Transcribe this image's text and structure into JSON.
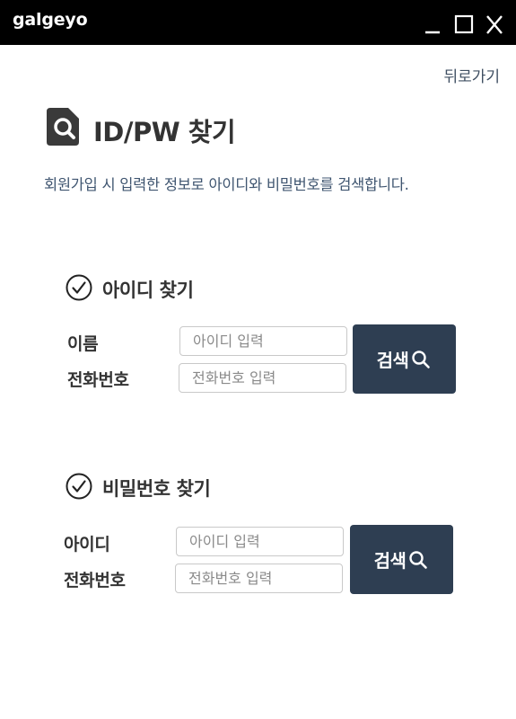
{
  "window": {
    "title": "galgeyo",
    "controls": [
      "minimize-icon",
      "maximize-icon",
      "close-icon"
    ]
  },
  "header": {
    "back_label": "뒤로가기",
    "title": "ID/PW 찾기",
    "description": "회원가입 시 입력한 정보로 아이디와 비밀번호를 검색합니다."
  },
  "find_id": {
    "title": "아이디 찾기",
    "name_label": "이름",
    "name_placeholder": "아이디 입력",
    "phone_label": "전화번호",
    "phone_placeholder": "전화번호 입력",
    "search_label": "검색"
  },
  "find_pw": {
    "title": "비밀번호 찾기",
    "id_label": "아이디",
    "id_placeholder": "아이디 입력",
    "phone_label": "전화번호",
    "phone_placeholder": "전화번호 입력",
    "search_label": "검색"
  },
  "colors": {
    "titlebar": "#000000",
    "button": "#2e3e52",
    "description_text": "#3f5570"
  }
}
